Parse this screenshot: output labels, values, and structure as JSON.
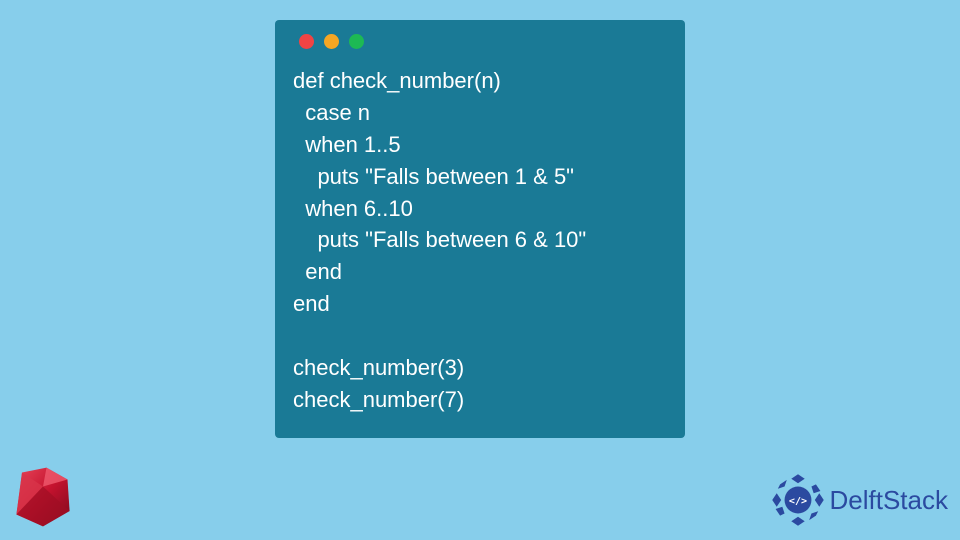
{
  "code": {
    "line1": "def check_number(n)",
    "line2": "  case n",
    "line3": "  when 1..5",
    "line4": "    puts \"Falls between 1 & 5\"",
    "line5": "  when 6..10",
    "line6": "    puts \"Falls between 6 & 10\"",
    "line7": "  end",
    "line8": "end",
    "line9": "",
    "line10": "check_number(3)",
    "line11": "check_number(7)"
  },
  "brand": {
    "name": "DelftStack"
  }
}
